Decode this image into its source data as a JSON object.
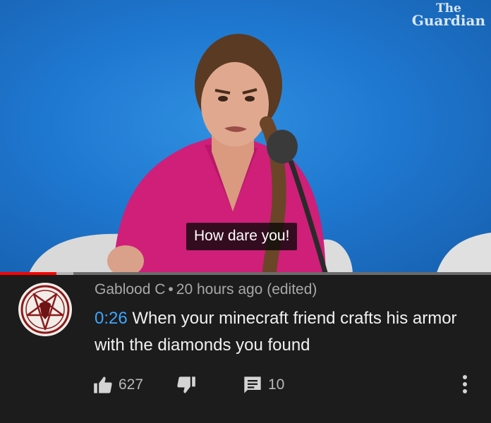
{
  "video": {
    "watermark_line1": "The",
    "watermark_line2": "Guardian",
    "caption": "How dare you!",
    "progress_played": 0.115,
    "progress_buffered": 0.15
  },
  "comment": {
    "author": "Gablood C",
    "separator": "•",
    "time_ago": "20 hours ago (edited)",
    "timestamp": "0:26",
    "text": "When your minecraft friend crafts his armor with the diamonds you found",
    "like_count": "627",
    "reply_count": "10"
  },
  "colors": {
    "background": "#1c1c1c",
    "timestamp_link": "#3ea6ff",
    "progress_red": "#ff0000"
  },
  "icons": {
    "like": "thumbs-up-icon",
    "dislike": "thumbs-down-icon",
    "reply": "comment-icon",
    "more": "more-vertical-icon"
  }
}
